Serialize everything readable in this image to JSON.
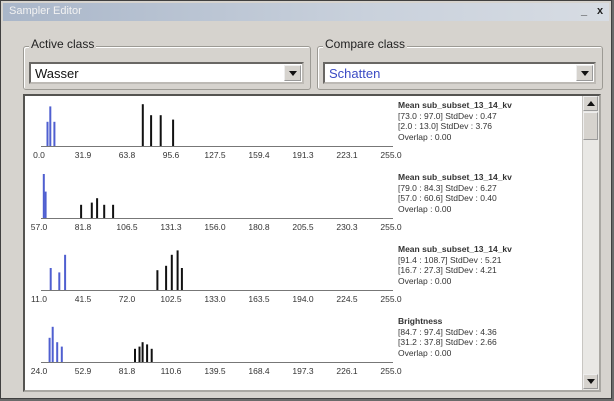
{
  "window": {
    "title": "Sampler Editor",
    "minimize_label": "_",
    "close_label": "x"
  },
  "active_class": {
    "label": "Active class",
    "value": "Wasser"
  },
  "compare_class": {
    "label": "Compare class",
    "value": "Schatten"
  },
  "colors": {
    "active": "#4f5fd0",
    "compare": "#111111"
  },
  "histograms": [
    {
      "ticks": [
        "0.0",
        "31.9",
        "63.8",
        "95.6",
        "127.5",
        "159.4",
        "191.3",
        "223.1",
        "255.0"
      ],
      "stats": [
        "Mean sub_subset_13_14_kv",
        "[73.0 : 97.0] StdDev : 0.47",
        "[2.0 : 13.0] StdDev : 3.76",
        "Overlap : 0.00"
      ],
      "chart_data": {
        "type": "bar",
        "x_range": [
          0.0,
          255.0
        ],
        "series": [
          {
            "values": [
              [
                4,
                0.55
              ],
              [
                6,
                0.9
              ],
              [
                9,
                0.55
              ]
            ]
          },
          {
            "values": [
              [
                73,
                0.95
              ],
              [
                79,
                0.7
              ],
              [
                86,
                0.7
              ],
              [
                95,
                0.6
              ]
            ]
          }
        ]
      }
    },
    {
      "ticks": [
        "57.0",
        "81.8",
        "106.5",
        "131.3",
        "156.0",
        "180.8",
        "205.5",
        "230.3",
        "255.0"
      ],
      "stats": [
        "Mean sub_subset_13_14_kv",
        "[79.0 : 84.3] StdDev : 6.27",
        "[57.0 : 60.6] StdDev : 0.40",
        "Overlap : 0.00"
      ],
      "chart_data": {
        "type": "bar",
        "x_range": [
          57.0,
          255.0
        ],
        "series": [
          {
            "values": [
              [
                58,
                1.0
              ],
              [
                59,
                0.6
              ]
            ]
          },
          {
            "values": [
              [
                79,
                0.3
              ],
              [
                85,
                0.35
              ],
              [
                88,
                0.45
              ],
              [
                92,
                0.3
              ],
              [
                97,
                0.3
              ]
            ]
          }
        ]
      }
    },
    {
      "ticks": [
        "11.0",
        "41.5",
        "72.0",
        "102.5",
        "133.0",
        "163.5",
        "194.0",
        "224.5",
        "255.0"
      ],
      "stats": [
        "Mean sub_subset_13_14_kv",
        "[91.4 : 108.7] StdDev : 5.21",
        "[16.7 : 27.3] StdDev : 4.21",
        "Overlap : 0.00"
      ],
      "chart_data": {
        "type": "bar",
        "x_range": [
          11.0,
          255.0
        ],
        "series": [
          {
            "values": [
              [
                17,
                0.5
              ],
              [
                23,
                0.4
              ],
              [
                27,
                0.8
              ]
            ]
          },
          {
            "values": [
              [
                91,
                0.45
              ],
              [
                97,
                0.55
              ],
              [
                101,
                0.8
              ],
              [
                105,
                0.9
              ],
              [
                108,
                0.5
              ]
            ]
          }
        ]
      }
    },
    {
      "ticks": [
        "24.0",
        "52.9",
        "81.8",
        "110.6",
        "139.5",
        "168.4",
        "197.3",
        "226.1",
        "255.0"
      ],
      "stats": [
        "Brightness",
        "[84.7 : 97.4] StdDev : 4.36",
        "[31.2 : 37.8] StdDev : 2.66",
        "Overlap : 0.00"
      ],
      "chart_data": {
        "type": "bar",
        "x_range": [
          24.0,
          255.0
        ],
        "series": [
          {
            "values": [
              [
                29,
                0.55
              ],
              [
                31,
                0.8
              ],
              [
                34,
                0.45
              ],
              [
                37,
                0.35
              ]
            ]
          },
          {
            "values": [
              [
                85,
                0.3
              ],
              [
                88,
                0.35
              ],
              [
                90,
                0.45
              ],
              [
                93,
                0.4
              ],
              [
                96,
                0.3
              ]
            ]
          }
        ]
      }
    }
  ]
}
